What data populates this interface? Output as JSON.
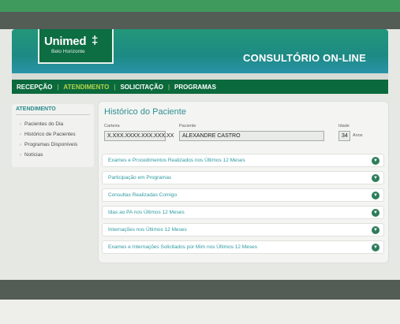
{
  "header": {
    "logo_main": "Unimed",
    "logo_sub": "Belo Horizonte",
    "title": "CONSULTÓRIO ON-LINE"
  },
  "nav": [
    {
      "label": "RECEPÇÃO"
    },
    {
      "label": "ATENDIMENTO",
      "active": true
    },
    {
      "label": "SOLICITAÇÃO"
    },
    {
      "label": "PROGRAMAS"
    }
  ],
  "sidebar": {
    "title": "ATENDIMENTO",
    "items": [
      {
        "label": "Pacientes do Dia"
      },
      {
        "label": "Histórico de Pacientes"
      },
      {
        "label": "Programas Disponíveis"
      },
      {
        "label": "Notícias"
      }
    ]
  },
  "main": {
    "title": "Histórico do Paciente",
    "fields": {
      "carteira_label": "Carteira",
      "carteira_value": "X.XXX.XXXX.XXX.XXX.XX",
      "paciente_label": "Paciente",
      "paciente_value": "ALEXANDRE CASTRO",
      "idade_label": "Idade",
      "idade_value": "34",
      "idade_unit": "Anos"
    },
    "sections": [
      {
        "label": "Exames e Procedimentos Realizados nos Últimos 12 Meses"
      },
      {
        "label": "Participação em Programas"
      },
      {
        "label": "Consultas Realizadas Comigo"
      },
      {
        "label": "Idas ao PA nos Últimos 12 Meses"
      },
      {
        "label": "Internações nos Últimos 12 Meses"
      },
      {
        "label": "Exames e Internações Solicitados por Mim nos Últimos 12 Meses"
      }
    ]
  },
  "colors": {
    "brand_green": "#0b6a3d",
    "accent_teal": "#2e9aa1",
    "nav_active": "#b5d54a"
  }
}
